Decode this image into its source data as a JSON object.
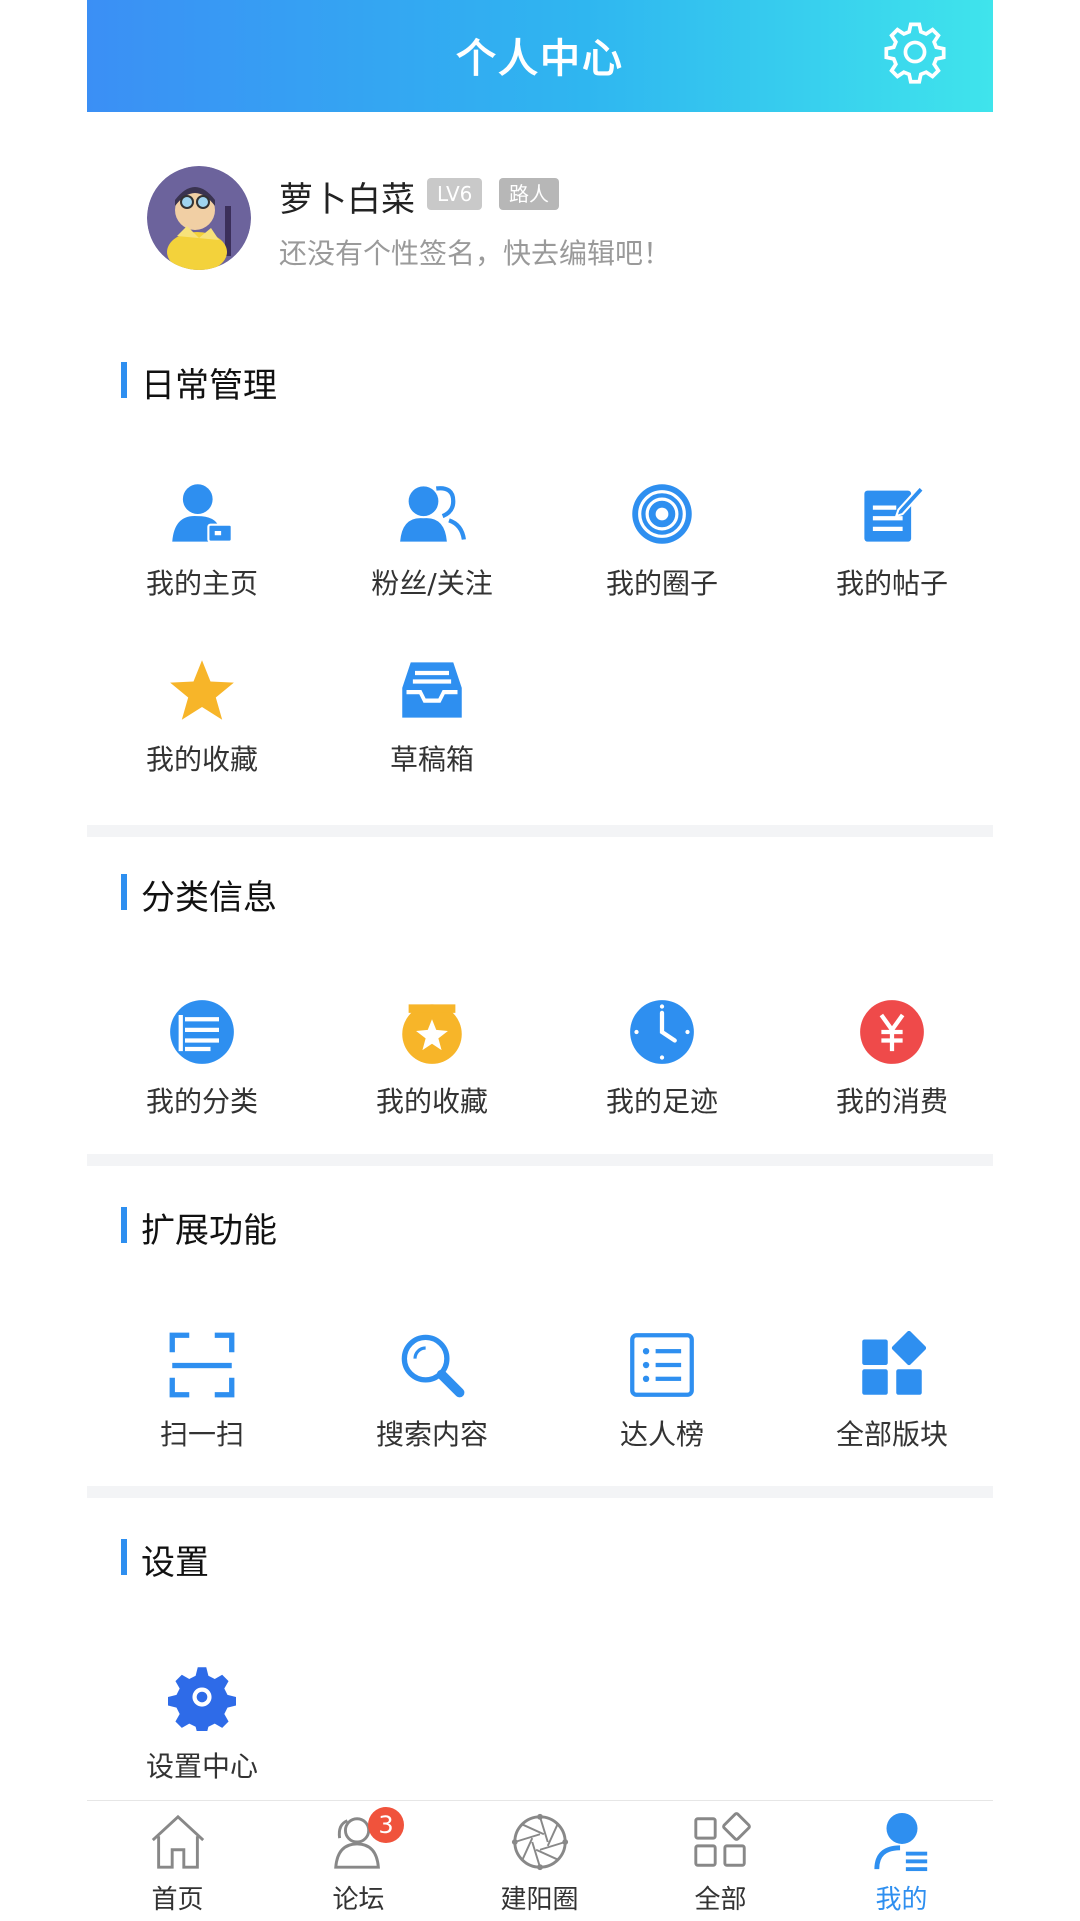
{
  "header": {
    "title": "个人中心"
  },
  "profile": {
    "username": "萝卜白菜",
    "level_badge": "LV6",
    "rank_badge": "路人",
    "signature": "还没有个性签名，快去编辑吧！"
  },
  "sections": {
    "daily": {
      "title": "日常管理",
      "items": [
        "我的主页",
        "粉丝/关注",
        "我的圈子",
        "我的帖子",
        "我的收藏",
        "草稿箱"
      ]
    },
    "category": {
      "title": "分类信息",
      "items": [
        "我的分类",
        "我的收藏",
        "我的足迹",
        "我的消费"
      ]
    },
    "extend": {
      "title": "扩展功能",
      "items": [
        "扫一扫",
        "搜索内容",
        "达人榜",
        "全部版块"
      ]
    },
    "settings": {
      "title": "设置",
      "items": [
        "设置中心"
      ]
    }
  },
  "tabbar": {
    "items": [
      "首页",
      "论坛",
      "建阳圈",
      "全部",
      "我的"
    ],
    "forum_badge": "3",
    "active": "我的"
  },
  "colors": {
    "accent": "#2e8ff0",
    "badge_red": "#f0533c",
    "star": "#f7b529"
  }
}
